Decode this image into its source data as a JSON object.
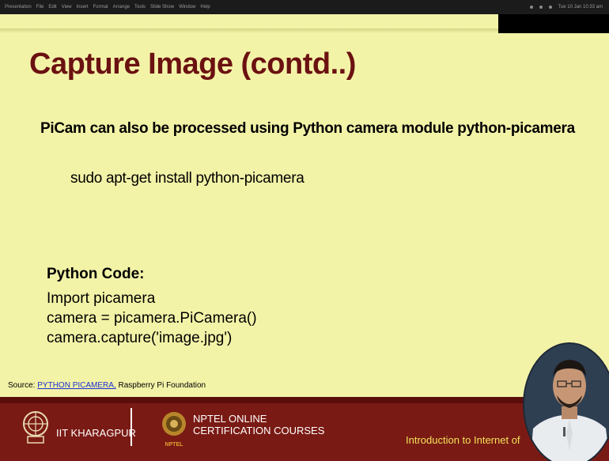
{
  "menubar": {
    "items": [
      "Presentation",
      "File",
      "Edit",
      "View",
      "Insert",
      "Format",
      "Arrange",
      "Tools",
      "Slide Show",
      "Window",
      "Help"
    ],
    "status": "Tue 10 Jan 10:33 am"
  },
  "slide": {
    "title": "Capture Image (contd..)",
    "lead": "PiCam can also be processed using Python camera module python-picamera",
    "command": "sudo apt-get install python-picamera",
    "code_heading": "Python Code:",
    "code_lines": [
      "Import picamera",
      "camera = picamera.PiCamera()",
      "camera.capture('image.jpg')"
    ],
    "source_label": "Source:",
    "source_link": "PYTHON PICAMERA,",
    "source_org": "Raspberry Pi Foundation"
  },
  "footer": {
    "iit": "IIT KHARAGPUR",
    "nptel_line1": "NPTEL ONLINE",
    "nptel_line2": "CERTIFICATION COURSES",
    "nptel_badge": "NPTEL",
    "course": "Introduction to Internet of"
  },
  "colors": {
    "background": "#f3f3a8",
    "title": "#6b1111",
    "footer": "#7a1a14",
    "footer_text_accent": "#f3e35a",
    "link": "#1a2fd0"
  }
}
